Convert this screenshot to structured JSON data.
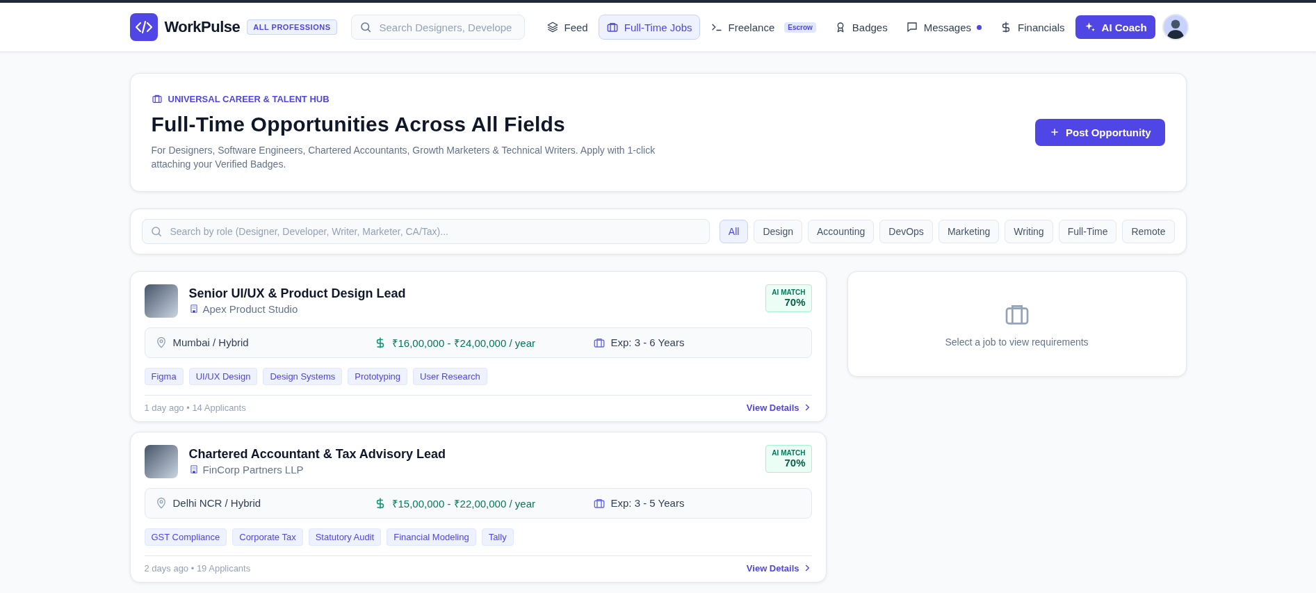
{
  "nav": {
    "brand": "WorkPulse",
    "brand_badge": "ALL PROFESSIONS",
    "search": {
      "placeholder": "Search Designers, Develope"
    },
    "items": [
      {
        "label": "Feed",
        "kind": "layers",
        "selected": false
      },
      {
        "label": "Full-Time Jobs",
        "kind": "briefcase",
        "selected": true
      },
      {
        "label": "Freelance",
        "kind": "terminal",
        "selected": false,
        "badge": "Escrow"
      },
      {
        "label": "Badges",
        "kind": "award",
        "selected": false
      },
      {
        "label": "Messages",
        "kind": "message",
        "selected": false,
        "unread": true
      },
      {
        "label": "Financials",
        "kind": "dollar",
        "selected": false
      }
    ],
    "coach_button": "AI Coach"
  },
  "hero": {
    "eyebrow": "UNIVERSAL CAREER & TALENT HUB",
    "title": "Full-Time Opportunities Across All Fields",
    "description": "For Designers, Software Engineers, Chartered Accountants, Growth Marketers & Technical Writers. Apply with 1-click attaching your Verified Badges.",
    "button": "Post Opportunity"
  },
  "filters": {
    "search": {
      "placeholder": "Search by role (Designer, Developer, Writer, Marketer, CA/Tax)..."
    },
    "chips": [
      {
        "label": "All",
        "selected": true
      },
      {
        "label": "Design",
        "selected": false
      },
      {
        "label": "Accounting",
        "selected": false
      },
      {
        "label": "DevOps",
        "selected": false
      },
      {
        "label": "Marketing",
        "selected": false
      },
      {
        "label": "Writing",
        "selected": false
      },
      {
        "label": "Full-Time",
        "selected": false
      },
      {
        "label": "Remote",
        "selected": false
      }
    ]
  },
  "jobs": [
    {
      "title": "Senior UI/UX & Product Design Lead",
      "company": "Apex Product Studio",
      "match_label": "AI MATCH",
      "match": "70%",
      "location": "Mumbai / Hybrid",
      "salary": "₹16,00,000 - ₹24,00,000 / year",
      "experience": "Exp: 3 - 6 Years",
      "tags": [
        "Figma",
        "UI/UX Design",
        "Design Systems",
        "Prototyping",
        "User Research"
      ],
      "meta": "1 day ago • 14 Applicants",
      "link": "View Details"
    },
    {
      "title": "Chartered Accountant & Tax Advisory Lead",
      "company": "FinCorp Partners LLP",
      "match_label": "AI MATCH",
      "match": "70%",
      "location": "Delhi NCR / Hybrid",
      "salary": "₹15,00,000 - ₹22,00,000 / year",
      "experience": "Exp: 3 - 5 Years",
      "tags": [
        "GST Compliance",
        "Corporate Tax",
        "Statutory Audit",
        "Financial Modeling",
        "Tally"
      ],
      "meta": "2 days ago • 19 Applicants",
      "link": "View Details"
    }
  ],
  "detail_panel": {
    "message": "Select a job to view requirements"
  }
}
